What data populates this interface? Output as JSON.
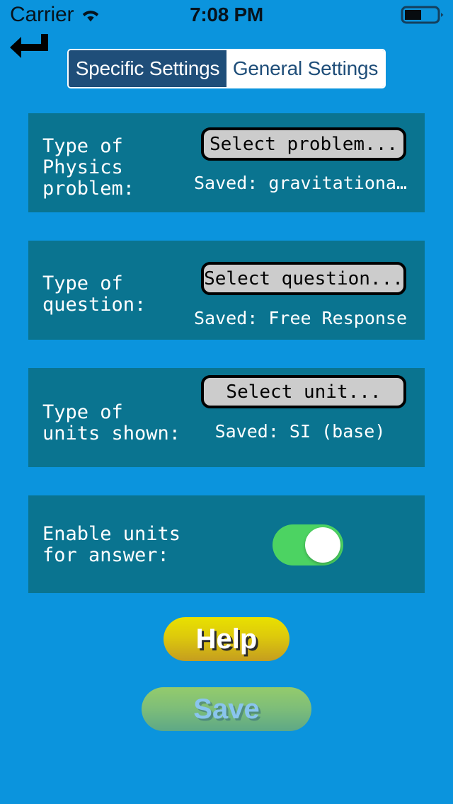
{
  "status_bar": {
    "carrier": "Carrier",
    "time": "7:08 PM",
    "wifi_icon": "wifi-icon",
    "battery_icon": "battery-half-icon"
  },
  "nav": {
    "back_icon": "back-return-arrow-icon"
  },
  "segmented_control": {
    "segments": [
      {
        "label": "Specific Settings",
        "selected": true
      },
      {
        "label": "General Settings",
        "selected": false
      }
    ]
  },
  "settings": [
    {
      "label": "Type of\nPhysics\nproblem:",
      "button_label": "Select problem...",
      "saved_text": "Saved: gravitationa…"
    },
    {
      "label": "Type of\nquestion:",
      "button_label": "Select question...",
      "saved_text": "Saved: Free Response"
    },
    {
      "label": "Type of\nunits shown:",
      "button_label": "Select unit...",
      "saved_text": "Saved: SI (base)"
    }
  ],
  "toggle_setting": {
    "label": "Enable units\nfor answer:",
    "state": "on"
  },
  "actions": {
    "help_label": "Help",
    "save_label": "Save"
  },
  "colors": {
    "background": "#0b94dd",
    "card": "#0a7490",
    "segment_selected": "#1f4e79",
    "toggle_on": "#4cd362",
    "help_button": "#ddc90c",
    "save_button": "#7dbd79",
    "save_text": "#8ac5ee"
  }
}
